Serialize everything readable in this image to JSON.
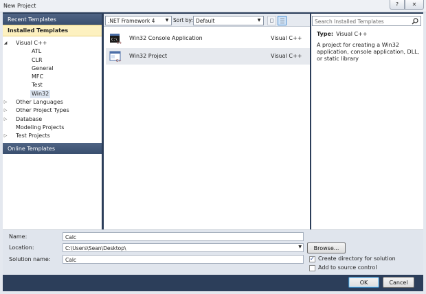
{
  "window": {
    "title": "New Project",
    "help_glyph": "?",
    "close_glyph": "✕"
  },
  "left": {
    "recent_header": "Recent Templates",
    "installed_header": "Installed Templates",
    "online_header": "Online Templates",
    "tree": [
      {
        "label": "Visual C++",
        "level": 0,
        "arrow": "◢"
      },
      {
        "label": "ATL",
        "level": 1,
        "arrow": ""
      },
      {
        "label": "CLR",
        "level": 1,
        "arrow": ""
      },
      {
        "label": "General",
        "level": 1,
        "arrow": ""
      },
      {
        "label": "MFC",
        "level": 1,
        "arrow": ""
      },
      {
        "label": "Test",
        "level": 1,
        "arrow": ""
      },
      {
        "label": "Win32",
        "level": 1,
        "arrow": ""
      },
      {
        "label": "Other Languages",
        "level": 0,
        "arrow": "▷"
      },
      {
        "label": "Other Project Types",
        "level": 0,
        "arrow": "▷"
      },
      {
        "label": "Database",
        "level": 0,
        "arrow": "▷"
      },
      {
        "label": "Modeling Projects",
        "level": 0,
        "arrow": ""
      },
      {
        "label": "Test Projects",
        "level": 0,
        "arrow": "▷"
      }
    ]
  },
  "toolbar": {
    "framework": ".NET Framework 4",
    "sort_label": "Sort by:",
    "sort_value": "Default"
  },
  "templates": [
    {
      "name": "Win32 Console Application",
      "lang": "Visual C++"
    },
    {
      "name": "Win32 Project",
      "lang": "Visual C++"
    }
  ],
  "details": {
    "search_placeholder": "Search Installed Templates",
    "type_key": "Type:",
    "type_value": "Visual C++",
    "description": "A project for creating a Win32 application, console application, DLL, or static library"
  },
  "form": {
    "name_label": "Name:",
    "name_value": "Calc",
    "location_label": "Location:",
    "location_value": "C:\\Users\\Sean\\Desktop\\",
    "solution_label": "Solution name:",
    "solution_value": "Calc",
    "browse": "Browse...",
    "create_dir": "Create directory for solution",
    "create_dir_checked": true,
    "source_control": "Add to source control",
    "source_control_checked": false,
    "ok": "OK",
    "cancel": "Cancel"
  },
  "colors": {
    "frame": "#2c3e5a",
    "header": "#4f6484",
    "selected": "#fdf1c0"
  }
}
